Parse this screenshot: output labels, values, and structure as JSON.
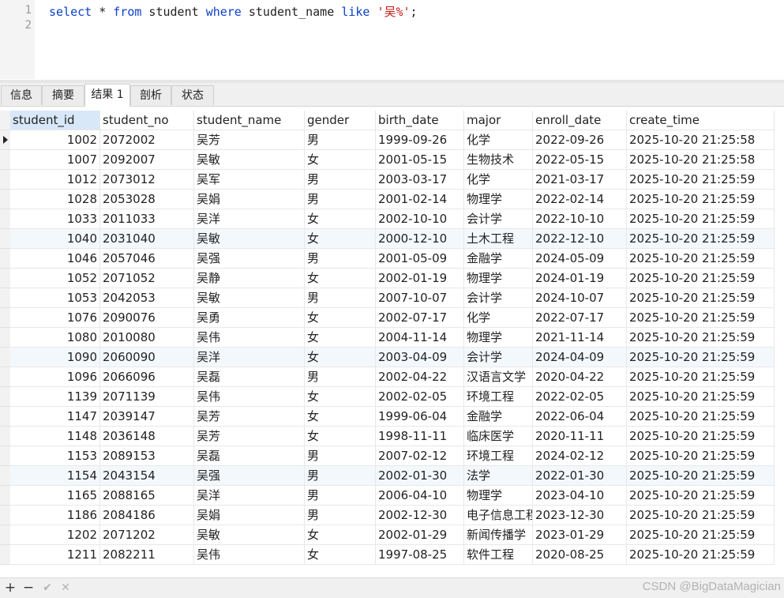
{
  "editor": {
    "line_numbers": [
      "1",
      "2"
    ],
    "query": {
      "kw_select": "select",
      "star": " * ",
      "kw_from": "from",
      "table": " student ",
      "kw_where": "where",
      "column": " student_name ",
      "kw_like": "like",
      "space": " ",
      "literal": "'吴%'",
      "semicolon": ";"
    }
  },
  "tabs": [
    "信息",
    "摘要",
    "结果 1",
    "剖析",
    "状态"
  ],
  "active_tab": "结果 1",
  "grid": {
    "columns": [
      "student_id",
      "student_no",
      "student_name",
      "gender",
      "birth_date",
      "major",
      "enroll_date",
      "create_time"
    ],
    "selected_column": "student_id",
    "rows": [
      [
        "1002",
        "2072002",
        "吴芳",
        "男",
        "1999-09-26",
        "化学",
        "2022-09-26",
        "2025-10-20 21:25:58"
      ],
      [
        "1007",
        "2092007",
        "吴敏",
        "女",
        "2001-05-15",
        "生物技术",
        "2022-05-15",
        "2025-10-20 21:25:58"
      ],
      [
        "1012",
        "2073012",
        "吴军",
        "男",
        "2003-03-17",
        "化学",
        "2021-03-17",
        "2025-10-20 21:25:59"
      ],
      [
        "1028",
        "2053028",
        "吴娟",
        "男",
        "2001-02-14",
        "物理学",
        "2022-02-14",
        "2025-10-20 21:25:59"
      ],
      [
        "1033",
        "2011033",
        "吴洋",
        "女",
        "2002-10-10",
        "会计学",
        "2022-10-10",
        "2025-10-20 21:25:59"
      ],
      [
        "1040",
        "2031040",
        "吴敏",
        "女",
        "2000-12-10",
        "土木工程",
        "2022-12-10",
        "2025-10-20 21:25:59"
      ],
      [
        "1046",
        "2057046",
        "吴强",
        "男",
        "2001-05-09",
        "金融学",
        "2024-05-09",
        "2025-10-20 21:25:59"
      ],
      [
        "1052",
        "2071052",
        "吴静",
        "女",
        "2002-01-19",
        "物理学",
        "2024-01-19",
        "2025-10-20 21:25:59"
      ],
      [
        "1053",
        "2042053",
        "吴敏",
        "男",
        "2007-10-07",
        "会计学",
        "2024-10-07",
        "2025-10-20 21:25:59"
      ],
      [
        "1076",
        "2090076",
        "吴勇",
        "女",
        "2002-07-17",
        "化学",
        "2022-07-17",
        "2025-10-20 21:25:59"
      ],
      [
        "1080",
        "2010080",
        "吴伟",
        "女",
        "2004-11-14",
        "物理学",
        "2021-11-14",
        "2025-10-20 21:25:59"
      ],
      [
        "1090",
        "2060090",
        "吴洋",
        "女",
        "2003-04-09",
        "会计学",
        "2024-04-09",
        "2025-10-20 21:25:59"
      ],
      [
        "1096",
        "2066096",
        "吴磊",
        "男",
        "2002-04-22",
        "汉语言文学",
        "2020-04-22",
        "2025-10-20 21:25:59"
      ],
      [
        "1139",
        "2071139",
        "吴伟",
        "女",
        "2002-02-05",
        "环境工程",
        "2022-02-05",
        "2025-10-20 21:25:59"
      ],
      [
        "1147",
        "2039147",
        "吴芳",
        "女",
        "1999-06-04",
        "金融学",
        "2022-06-04",
        "2025-10-20 21:25:59"
      ],
      [
        "1148",
        "2036148",
        "吴芳",
        "女",
        "1998-11-11",
        "临床医学",
        "2020-11-11",
        "2025-10-20 21:25:59"
      ],
      [
        "1153",
        "2089153",
        "吴磊",
        "男",
        "2007-02-12",
        "环境工程",
        "2024-02-12",
        "2025-10-20 21:25:59"
      ],
      [
        "1154",
        "2043154",
        "吴强",
        "男",
        "2002-01-30",
        "法学",
        "2022-01-30",
        "2025-10-20 21:25:59"
      ],
      [
        "1165",
        "2088165",
        "吴洋",
        "男",
        "2006-04-10",
        "物理学",
        "2023-04-10",
        "2025-10-20 21:25:59"
      ],
      [
        "1186",
        "2084186",
        "吴娟",
        "男",
        "2002-12-30",
        "电子信息工程",
        "2023-12-30",
        "2025-10-20 21:25:59"
      ],
      [
        "1202",
        "2071202",
        "吴敏",
        "女",
        "2002-01-29",
        "新闻传播学",
        "2023-01-29",
        "2025-10-20 21:25:59"
      ],
      [
        "1211",
        "2082211",
        "吴伟",
        "女",
        "1997-08-25",
        "软件工程",
        "2020-08-25",
        "2025-10-20 21:25:59"
      ]
    ],
    "current_row": 0,
    "highlighted_rows": [
      5,
      11,
      17
    ]
  },
  "toolbar": {
    "add_icon": "plus-icon",
    "add_glyph": "+",
    "delete_icon": "minus-icon",
    "delete_glyph": "−",
    "apply_icon": "check-icon",
    "apply_glyph": "✔",
    "cancel_icon": "close-icon",
    "cancel_glyph": "✕"
  },
  "watermark": "CSDN @BigDataMagician",
  "colors": {
    "keyword": "#0b40c8",
    "string": "#c41a16",
    "selected_header": "#d8e8f8",
    "row_highlight": "#f3f8fd",
    "toolbar_disabled": "#b4b4b4"
  }
}
